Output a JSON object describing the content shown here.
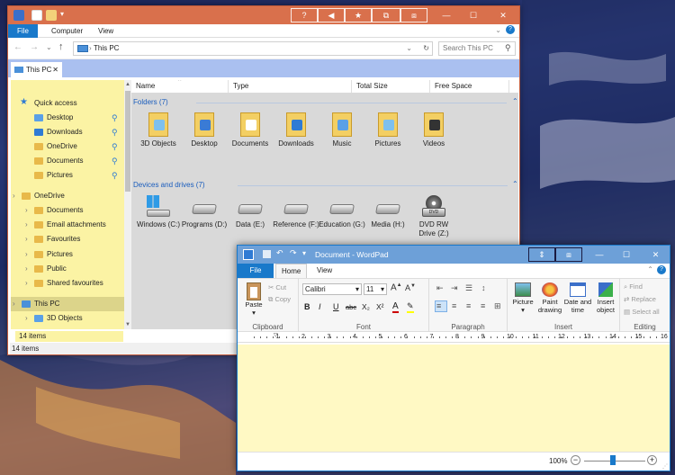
{
  "explorer": {
    "title_buttons": [
      "?",
      "◀",
      "★",
      "⧉",
      "⧈"
    ],
    "window_controls": {
      "minimize": "—",
      "maximize": "☐",
      "close": "✕"
    },
    "tabs": [
      "File",
      "Computer",
      "View"
    ],
    "address": "This PC",
    "search_placeholder": "Search This PC",
    "tab_label": "This PC",
    "tab_close": "✕",
    "nav_items": [
      {
        "label": "Quick access"
      },
      {
        "label": "Desktop"
      },
      {
        "label": "Downloads"
      },
      {
        "label": "OneDrive"
      },
      {
        "label": "Documents"
      },
      {
        "label": "Pictures"
      },
      {
        "label": "OneDrive"
      },
      {
        "label": "Documents"
      },
      {
        "label": "Email attachments"
      },
      {
        "label": "Favourites"
      },
      {
        "label": "Pictures"
      },
      {
        "label": "Public"
      },
      {
        "label": "Shared favourites"
      },
      {
        "label": "This PC"
      },
      {
        "label": "3D Objects"
      }
    ],
    "columns": [
      "Name",
      "Type",
      "Total Size",
      "Free Space"
    ],
    "folders_header": "Folders (7)",
    "folders": [
      "3D Objects",
      "Desktop",
      "Documents",
      "Downloads",
      "Music",
      "Pictures",
      "Videos"
    ],
    "drives_header": "Devices and drives (7)",
    "drives": [
      "Windows (C:)",
      "Programs (D:)",
      "Data (E:)",
      "Reference (F:)",
      "Education (G:)",
      "Media (H:)",
      "DVD RW Drive (Z:)"
    ],
    "status_inner": "14 items",
    "status_outer": "14 items"
  },
  "wordpad": {
    "title": "Document - WordPad",
    "window_controls": {
      "minimize": "—",
      "maximize": "☐",
      "close": "✕"
    },
    "tabs": [
      "File",
      "Home",
      "View"
    ],
    "clipboard": {
      "paste": "Paste",
      "cut": "Cut",
      "copy": "Copy",
      "label": "Clipboard"
    },
    "font": {
      "family": "Calibri",
      "size": "11",
      "label": "Font",
      "bold": "B",
      "italic": "I",
      "underline": "U",
      "strike": "abc",
      "sub": "X₂",
      "sup": "X²"
    },
    "paragraph_label": "Paragraph",
    "insert": {
      "picture": "Picture",
      "paint": "Paint drawing",
      "datetime": "Date and time",
      "object": "Insert object",
      "label": "Insert"
    },
    "editing": {
      "find": "Find",
      "replace": "Replace",
      "select_all": "Select all",
      "label": "Editing"
    },
    "ruler_marks": [
      "1",
      "2",
      "3",
      "4",
      "5",
      "6",
      "7",
      "8",
      "9",
      "10",
      "11",
      "12",
      "13",
      "14",
      "15",
      "16"
    ],
    "zoom": "100%"
  },
  "colors": {
    "explorer_title": "#d9704c",
    "wordpad_title": "#6da0d8",
    "nav_bg": "#fbf3a4",
    "doc_bg": "#fff9c4",
    "accent": "#1979ca"
  }
}
